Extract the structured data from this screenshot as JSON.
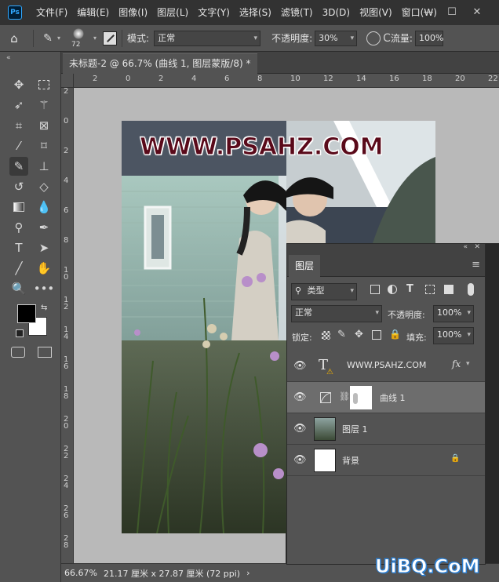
{
  "app": {
    "logo": "Ps"
  },
  "menu": [
    "文件(F)",
    "编辑(E)",
    "图像(I)",
    "图层(L)",
    "文字(Y)",
    "选择(S)",
    "滤镜(T)",
    "3D(D)",
    "视图(V)",
    "窗口(W)"
  ],
  "window_controls": {
    "minimize": "—",
    "maximize": "☐",
    "close": "✕"
  },
  "options": {
    "brush_size": "72",
    "mode_label": "模式:",
    "mode_value": "正常",
    "opacity_label": "不透明度:",
    "opacity_value": "30%",
    "flow_label": "流量:",
    "flow_value": "100%"
  },
  "document": {
    "tab_title": "未标题-2 @ 66.7% (曲线 1, 图层蒙版/8) *",
    "tab_close": "×",
    "zoom": "66.67%",
    "dimensions": "21.17 厘米 x 27.87 厘米 (72 ppi)",
    "status_arrow": "›"
  },
  "rulers": {
    "top": [
      "2",
      "0",
      "2",
      "4",
      "6",
      "8",
      "10",
      "12",
      "14",
      "16",
      "18",
      "20",
      "22"
    ],
    "left": [
      "2",
      "0",
      "2",
      "4",
      "6",
      "8",
      "1 0",
      "1 2",
      "1 4",
      "1 6",
      "1 8",
      "2 0",
      "2 2",
      "2 4",
      "2 6",
      "2 8"
    ]
  },
  "watermark_text": "WWW.PSAHZ.COM",
  "site_badge": "UiBQ.CoM",
  "layers_panel": {
    "title": "图层",
    "collapse": "«",
    "close": "✕",
    "menu_icon": "≡",
    "filter_kind": "类型",
    "blend_mode": "正常",
    "opacity_label": "不透明度:",
    "opacity_value": "100%",
    "lock_label": "锁定:",
    "fill_label": "填充:",
    "fill_value": "100%",
    "layers": [
      {
        "name": "WWW.PSAHZ.COM",
        "type": "text",
        "fx": "fx"
      },
      {
        "name": "曲线 1",
        "type": "adjustment",
        "selected": true
      },
      {
        "name": "图层 1",
        "type": "image"
      },
      {
        "name": "背景",
        "type": "background",
        "locked": true
      }
    ]
  },
  "colors": {
    "accent": "#31a8ff",
    "foreground": "#000000",
    "background": "#ffffff"
  }
}
